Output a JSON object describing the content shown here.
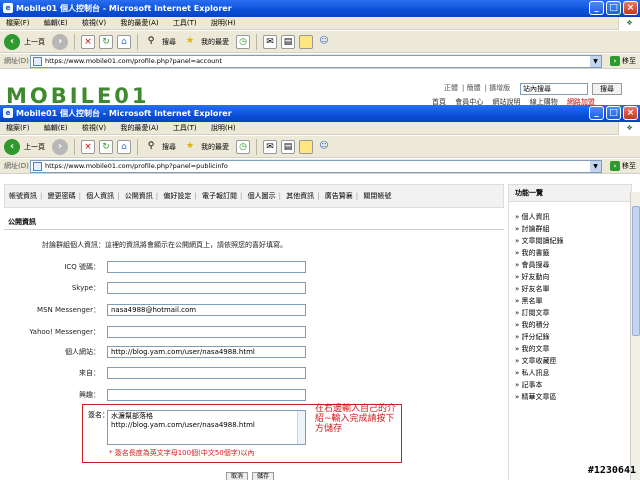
{
  "back_window": {
    "title": "Mobile01 個人控制台 - Microsoft Internet Explorer",
    "menu": [
      "檔案(F)",
      "編輯(E)",
      "檢視(V)",
      "我的最愛(A)",
      "工具(T)",
      "說明(H)"
    ],
    "toolbar": {
      "back": "上一頁",
      "search": "搜尋",
      "favorites": "我的最愛"
    },
    "address_label": "網址(D)",
    "url": "https://www.mobile01.com/profile.php?panel=account",
    "go": "移至",
    "logo": "MOBILE01",
    "top_links": [
      "正體",
      "簡體",
      "擴增版"
    ],
    "search_placeholder": "站內搜尋",
    "search_button": "搜尋",
    "nav_partial": [
      "首頁",
      "會員中心",
      "網站說明",
      "線上購物",
      "網路加盟"
    ]
  },
  "front_window": {
    "title": "Mobile01 個人控制台 - Microsoft Internet Explorer",
    "menu": [
      "檔案(F)",
      "編輯(E)",
      "檢視(V)",
      "我的最愛(A)",
      "工具(T)",
      "說明(H)"
    ],
    "toolbar": {
      "back": "上一頁",
      "search": "搜尋",
      "favorites": "我的最愛"
    },
    "address_label": "網址(D)",
    "url": "https://www.mobile01.com/profile.php?panel=publicinfo",
    "go": "移至"
  },
  "tabs": [
    "帳號資訊",
    "變更密碼",
    "個人資訊",
    "公開資訊",
    "偏好設定",
    "電子報訂閱",
    "個人圖示",
    "其他資訊",
    "廣告贊襄",
    "關閉帳號"
  ],
  "section": {
    "title": "公開資訊",
    "intro": "討論群組個人資訊：這裡的資訊將會顯示在公開網頁上，請依照您的喜好填寫。"
  },
  "fields": [
    {
      "label": "ICQ 號碼：",
      "value": ""
    },
    {
      "label": "Skype：",
      "value": ""
    },
    {
      "label": "MSN Messenger：",
      "value": "nasa4988@hotmail.com"
    },
    {
      "label": "Yahoo! Messenger：",
      "value": ""
    },
    {
      "label": "個人網站：",
      "value": "http://blog.yam.com/user/nasa4988.html"
    },
    {
      "label": "來自：",
      "value": ""
    },
    {
      "label": "興趣：",
      "value": ""
    }
  ],
  "signature": {
    "label": "簽名：",
    "lines": [
      "水濂幫部落格",
      "http://blog.yam.com/user/nasa4988.html"
    ],
    "note": "* 簽名長度為英文字母100個(中文50個字)以內"
  },
  "annotation": "在右邊輸入自己的介紹~輸入完成請按下方儲存",
  "buttons": {
    "cancel": "取消",
    "save": "儲存"
  },
  "sidebar": {
    "title": "功能一覽",
    "items": [
      "» 個人資訊",
      "» 討論群組",
      "» 文章閱讀紀錄",
      "» 我的書籤",
      "» 會員搜尋",
      "» 好友動向",
      "» 好友名單",
      "» 黑名單",
      "» 訂閱文章",
      "» 我的積分",
      "» 評分紀錄",
      "» 我的文章",
      "» 文章收藏匣",
      "» 私人訊息",
      "» 記事本",
      "» 精華文章區"
    ]
  },
  "watermark": "#1230641"
}
